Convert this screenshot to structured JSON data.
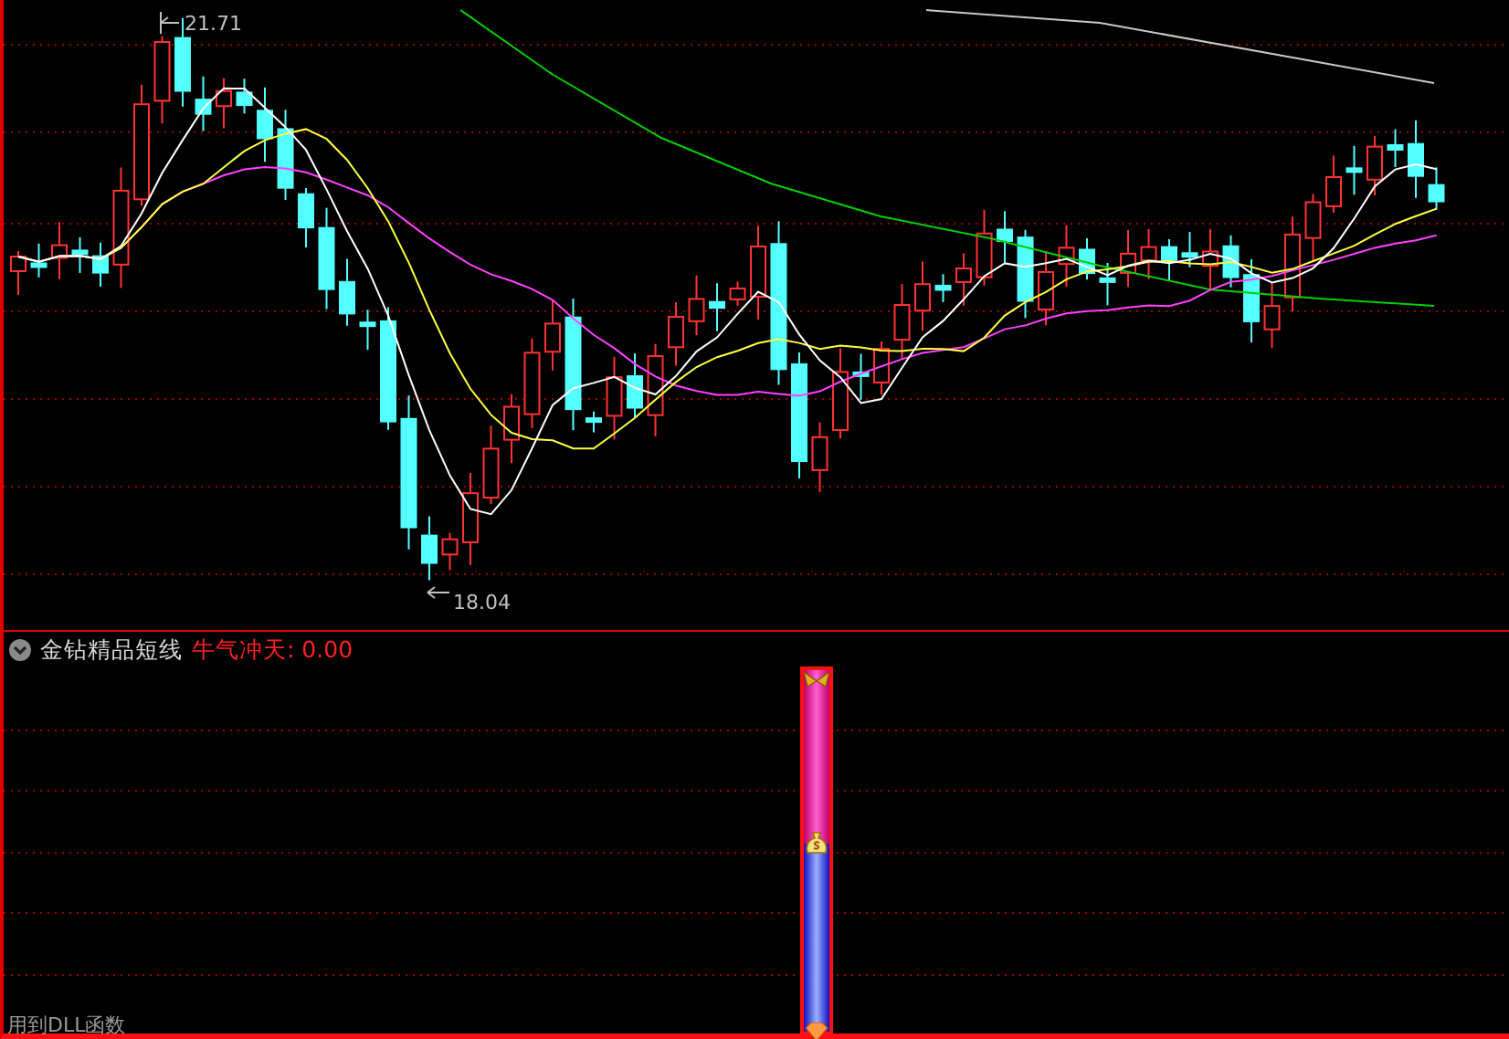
{
  "price_panel": {
    "high_label": "21.71",
    "low_label": "18.04"
  },
  "indicator_panel": {
    "title": "金钻精品短线",
    "reading": "牛气冲天: 0.00",
    "meter": {
      "level": 0.52
    }
  },
  "footer_note": "用到DLL函数"
}
